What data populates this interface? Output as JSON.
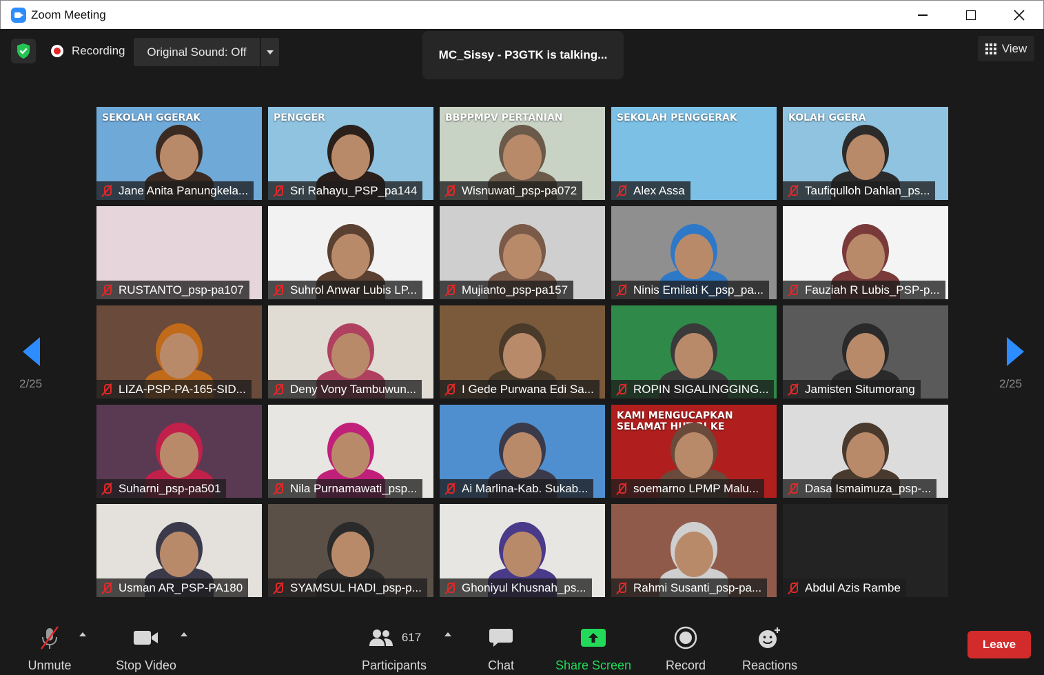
{
  "window": {
    "title": "Zoom Meeting"
  },
  "top": {
    "recording_label": "Recording",
    "original_sound_label": "Original Sound: Off",
    "talking_label": "MC_Sissy - P3GTK is talking...",
    "view_label": "View"
  },
  "pagination": {
    "left": "2/25",
    "right": "2/25"
  },
  "tiles": [
    {
      "name": "Jane Anita Panungkela...",
      "bg": "#6fa9d8",
      "tone": "#3a2a22",
      "overlay": "SEKOLAH GGERAK"
    },
    {
      "name": "Sri Rahayu_PSP_pa144",
      "bg": "#8fc3e0",
      "tone": "#2a1f1a",
      "overlay": "PENGGER"
    },
    {
      "name": "Wisnuwati_psp-pa072",
      "bg": "#c9d3c5",
      "tone": "#6b5a4a",
      "overlay": "BBPPMPV PERTANIAN"
    },
    {
      "name": "Alex Assa",
      "bg": "#7cc0e5",
      "tone": "",
      "overlay": "SEKOLAH PENGGERAK"
    },
    {
      "name": "Taufiqulloh Dahlan_ps...",
      "bg": "#8fc3e0",
      "tone": "#2b2b2b",
      "overlay": "KOLAH GGERA"
    },
    {
      "name": "RUSTANTO_psp-pa107",
      "bg": "#e6d5da",
      "tone": "",
      "overlay": ""
    },
    {
      "name": "Suhrol Anwar Lubis LP...",
      "bg": "#f2f2f2",
      "tone": "#5a4030",
      "overlay": ""
    },
    {
      "name": "Mujianto_psp-pa157",
      "bg": "#cfcfcf",
      "tone": "#7a5a48",
      "overlay": ""
    },
    {
      "name": "Ninis Emilati K_psp_pa...",
      "bg": "#8f8f8f",
      "tone": "#2e78c8",
      "overlay": ""
    },
    {
      "name": "Fauziah R Lubis_PSP-p...",
      "bg": "#f4f4f4",
      "tone": "#7a3a3a",
      "overlay": ""
    },
    {
      "name": "LIZA-PSP-PA-165-SID...",
      "bg": "#6a4a3a",
      "tone": "#c06a1a",
      "overlay": ""
    },
    {
      "name": "Deny Vony Tambuwun...",
      "bg": "#e0dbd3",
      "tone": "#b04060",
      "overlay": ""
    },
    {
      "name": "I Gede Purwana Edi Sa...",
      "bg": "#7a5a3a",
      "tone": "#4a3a2a",
      "overlay": ""
    },
    {
      "name": "ROPIN SIGALINGGING...",
      "bg": "#2f8a4a",
      "tone": "#3a3a3a",
      "overlay": ""
    },
    {
      "name": "Jamisten Situmorang",
      "bg": "#5a5a5a",
      "tone": "#2a2a2a",
      "overlay": ""
    },
    {
      "name": "Suharni_psp-pa501",
      "bg": "#5a3a52",
      "tone": "#c0204a",
      "overlay": ""
    },
    {
      "name": "Nila Purnamawati_psp...",
      "bg": "#e8e6e2",
      "tone": "#c0207a",
      "overlay": ""
    },
    {
      "name": "Ai Marlina-Kab. Sukab...",
      "bg": "#4f8fcf",
      "tone": "#3a3a4a",
      "overlay": ""
    },
    {
      "name": "soemarno LPMP Malu...",
      "bg": "#b01e1e",
      "tone": "#6a4a3a",
      "overlay": "KAMI MENGUCAPKAN SELAMAT HUT RI KE"
    },
    {
      "name": "Dasa Ismaimuza_psp-...",
      "bg": "#dcdcdc",
      "tone": "#4a3a2e",
      "overlay": ""
    },
    {
      "name": "Usman AR_PSP-PA180",
      "bg": "#e4e0dc",
      "tone": "#3a3a4a",
      "overlay": ""
    },
    {
      "name": "SYAMSUL HADI_psp-p...",
      "bg": "#5a5048",
      "tone": "#2a2a2a",
      "overlay": ""
    },
    {
      "name": "Ghoniyul Khusnah_ps...",
      "bg": "#e8e6e2",
      "tone": "#4a3a8a",
      "overlay": ""
    },
    {
      "name": "Rahmi Susanti_psp-pa...",
      "bg": "#8f5a4a",
      "tone": "#cfcfcf",
      "overlay": ""
    },
    {
      "name": "Abdul Azis Rambe",
      "bg": "#232323",
      "tone": "",
      "overlay": ""
    }
  ],
  "toolbar": {
    "unmute": "Unmute",
    "stop_video": "Stop Video",
    "participants": "Participants",
    "participants_count": "617",
    "chat": "Chat",
    "share_screen": "Share Screen",
    "record": "Record",
    "reactions": "Reactions",
    "leave": "Leave"
  },
  "colors": {
    "accent": "#2d8cff",
    "share_green": "#23d959",
    "leave_red": "#d32b2b",
    "muted_red": "#e02828"
  }
}
